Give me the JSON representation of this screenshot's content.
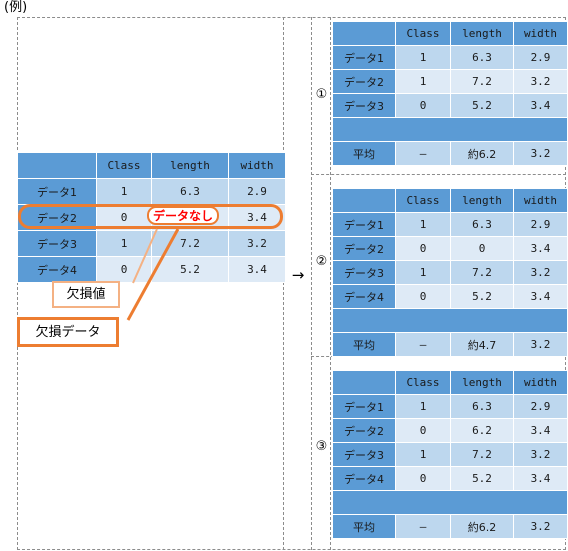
{
  "caption": "(例)",
  "arrow": "→",
  "columns": [
    "",
    "Class",
    "length",
    "width"
  ],
  "left_table": {
    "headers": [
      "",
      "Class",
      "length",
      "width"
    ],
    "rows": [
      {
        "label": "データ1",
        "class": "1",
        "length": "6.3",
        "width": "2.9"
      },
      {
        "label": "データ2",
        "class": "0",
        "length": "",
        "width": "3.4"
      },
      {
        "label": "データ3",
        "class": "1",
        "length": "7.2",
        "width": "3.2"
      },
      {
        "label": "データ4",
        "class": "0",
        "length": "5.2",
        "width": "3.4"
      }
    ]
  },
  "callouts": {
    "no_data": "データなし",
    "missing_value": "欠損値",
    "missing_data": "欠損データ"
  },
  "variants": [
    {
      "marker": "①",
      "headers": [
        "",
        "Class",
        "length",
        "width"
      ],
      "rows": [
        {
          "label": "データ1",
          "class": "1",
          "length": "6.3",
          "width": "2.9"
        },
        {
          "label": "データ2",
          "class": "1",
          "length": "7.2",
          "width": "3.2"
        },
        {
          "label": "データ3",
          "class": "0",
          "length": "5.2",
          "width": "3.4"
        }
      ],
      "average": {
        "label": "平均",
        "class": "–",
        "length": "約6.2",
        "width": "3.2"
      }
    },
    {
      "marker": "②",
      "headers": [
        "",
        "Class",
        "length",
        "width"
      ],
      "rows": [
        {
          "label": "データ1",
          "class": "1",
          "length": "6.3",
          "width": "2.9"
        },
        {
          "label": "データ2",
          "class": "0",
          "length": "0",
          "width": "3.4",
          "length_highlight": "red"
        },
        {
          "label": "データ3",
          "class": "1",
          "length": "7.2",
          "width": "3.2"
        },
        {
          "label": "データ4",
          "class": "0",
          "length": "5.2",
          "width": "3.4"
        }
      ],
      "average": {
        "label": "平均",
        "class": "–",
        "length": "約4.7",
        "width": "3.2"
      }
    },
    {
      "marker": "③",
      "headers": [
        "",
        "Class",
        "length",
        "width"
      ],
      "rows": [
        {
          "label": "データ1",
          "class": "1",
          "length": "6.3",
          "width": "2.9"
        },
        {
          "label": "データ2",
          "class": "0",
          "length": "6.2",
          "width": "3.4",
          "length_highlight": "red"
        },
        {
          "label": "データ3",
          "class": "1",
          "length": "7.2",
          "width": "3.2"
        },
        {
          "label": "データ4",
          "class": "0",
          "length": "5.2",
          "width": "3.4"
        }
      ],
      "average": {
        "label": "平均",
        "class": "–",
        "length": "約6.2",
        "width": "3.2"
      }
    }
  ],
  "colors": {
    "header_blue": "#5b9bd5",
    "row_a": "#bdd7ee",
    "row_b": "#deeaf6",
    "accent_orange": "#ed7d31",
    "accent_light_orange": "#f4b183",
    "highlight_red": "#ff0000",
    "frame_gray": "#8c8c8c"
  }
}
